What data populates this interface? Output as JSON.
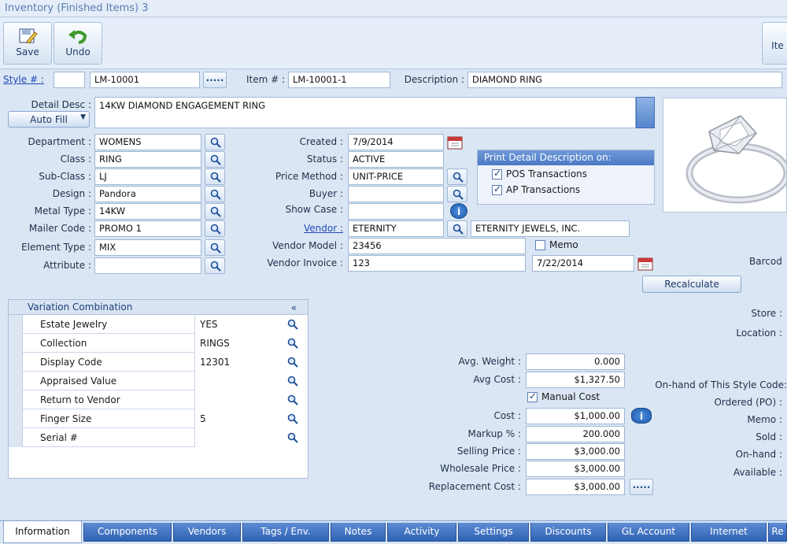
{
  "window": {
    "title": "Inventory (Finished Items) 3"
  },
  "toolbar": {
    "save_label": "Save",
    "undo_label": "Undo",
    "right_label": "Ite"
  },
  "header": {
    "style_label": "Style # :",
    "style_value": "",
    "style_code": "LM-10001",
    "item_label": "Item # :",
    "item_value": "LM-10001-1",
    "description_label": "Description :",
    "description_value": "DIAMOND RING",
    "dots": "....."
  },
  "detail": {
    "label": "Detail Desc :",
    "value": "14KW DIAMOND ENGAGEMENT RING",
    "autofill_label": "Auto Fill"
  },
  "left_fields": [
    {
      "label": "Department :",
      "value": "WOMENS"
    },
    {
      "label": "Class :",
      "value": "RING"
    },
    {
      "label": "Sub-Class :",
      "value": "LJ"
    },
    {
      "label": "Design :",
      "value": "Pandora"
    },
    {
      "label": "Metal Type :",
      "value": "14KW"
    },
    {
      "label": "Mailer Code :",
      "value": "PROMO 1"
    },
    {
      "label": "Element Type :",
      "value": "MIX"
    },
    {
      "label": "Attribute :",
      "value": ""
    }
  ],
  "mid_fields": {
    "created_label": "Created :",
    "created_value": "7/9/2014",
    "status_label": "Status :",
    "status_value": "ACTIVE",
    "price_method_label": "Price Method :",
    "price_method_value": "UNIT-PRICE",
    "buyer_label": "Buyer :",
    "buyer_value": "",
    "showcase_label": "Show Case :",
    "showcase_value": "",
    "vendor_label": "Vendor :",
    "vendor_value": "ETERNITY",
    "vendor_name": "ETERNITY JEWELS, INC.",
    "vendor_model_label": "Vendor Model :",
    "vendor_model_value": "23456",
    "vendor_invoice_label": "Vendor Invoice :",
    "vendor_invoice_value": "123",
    "memo_label": "Memo",
    "invoice_date": "7/22/2014",
    "recalculate_label": "Recalculate"
  },
  "print_panel": {
    "title": "Print Detail Description on:",
    "pos_label": "POS Transactions",
    "pos_checked": true,
    "ap_label": "AP Transactions",
    "ap_checked": true
  },
  "variation": {
    "title": "Variation Combination",
    "collapse_glyph": "«",
    "rows": [
      {
        "name": "Estate Jewelry",
        "value": "YES"
      },
      {
        "name": "Collection",
        "value": "RINGS"
      },
      {
        "name": "Display Code",
        "value": "12301"
      },
      {
        "name": "Appraised Value",
        "value": ""
      },
      {
        "name": "Return to Vendor",
        "value": ""
      },
      {
        "name": "Finger Size",
        "value": "5"
      },
      {
        "name": "Serial #",
        "value": ""
      }
    ]
  },
  "costs": {
    "avg_weight_label": "Avg. Weight :",
    "avg_weight": "0.000",
    "avg_cost_label": "Avg Cost :",
    "avg_cost": "$1,327.50",
    "manual_cost_label": "Manual Cost",
    "manual_cost_checked": true,
    "cost_label": "Cost :",
    "cost": "$1,000.00",
    "markup_label": "Markup % :",
    "markup": "200.000",
    "selling_label": "Selling Price :",
    "selling": "$3,000.00",
    "wholesale_label": "Wholesale Price :",
    "wholesale": "$3,000.00",
    "replacement_label": "Replacement Cost :",
    "replacement": "$3,000.00"
  },
  "right_labels": {
    "barcode": "Barcod",
    "store": "Store :",
    "location": "Location :",
    "onhand_style": "On-hand of This Style Code:",
    "ordered": "Ordered (PO) :",
    "memo": "Memo :",
    "sold": "Sold :",
    "onhand": "On-hand :",
    "available": "Available :"
  },
  "tabs": [
    "Information",
    "Components",
    "Vendors",
    "Tags / Env.",
    "Notes",
    "Activity",
    "Settings",
    "Discounts",
    "GL Account",
    "Internet",
    "Re"
  ],
  "active_tab": "Information",
  "colors": {
    "accent": "#4b79c4",
    "background": "#dbe6f4",
    "link": "#1f48b4"
  },
  "icons": {
    "search": "magnifier-icon",
    "calendar": "calendar-icon",
    "info": "info-icon",
    "save": "save-icon",
    "undo": "undo-icon"
  }
}
